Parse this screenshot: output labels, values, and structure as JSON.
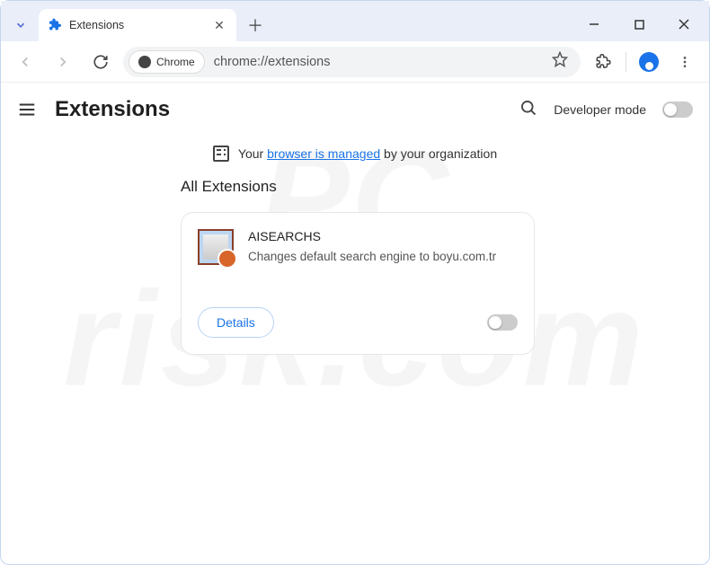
{
  "tab": {
    "title": "Extensions"
  },
  "omnibox": {
    "chip_label": "Chrome",
    "url": "chrome://extensions"
  },
  "header": {
    "title": "Extensions",
    "dev_mode_label": "Developer mode"
  },
  "managed_banner": {
    "prefix": "Your ",
    "link": "browser is managed",
    "suffix": " by your organization"
  },
  "section": {
    "title": "All Extensions"
  },
  "extensions": [
    {
      "name": "AISEARCHS",
      "description": "Changes default search engine to boyu.com.tr",
      "enabled": false
    }
  ],
  "buttons": {
    "details": "Details"
  }
}
